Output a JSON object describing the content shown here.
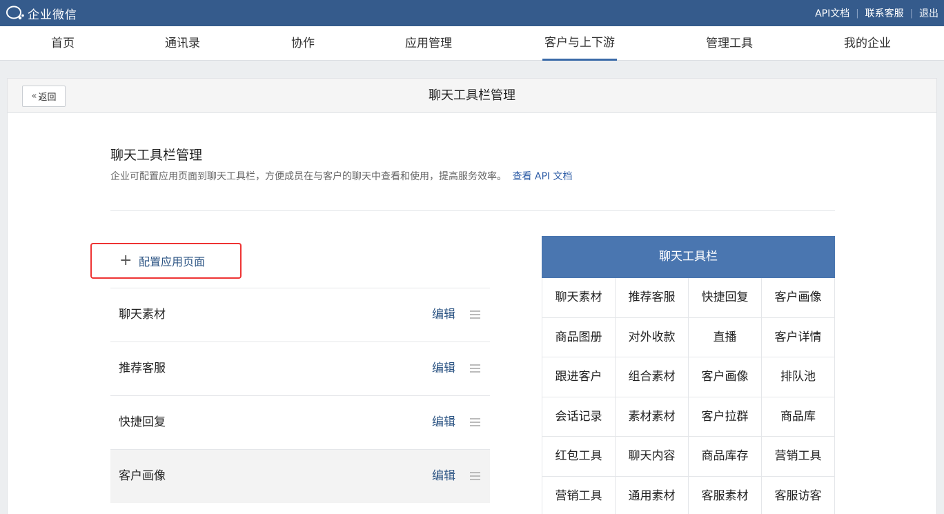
{
  "topbar": {
    "logo_text": "企业微信",
    "links": [
      "API文档",
      "联系客服",
      "退出"
    ]
  },
  "nav": {
    "items": [
      "首页",
      "通讯录",
      "协作",
      "应用管理",
      "客户与上下游",
      "管理工具",
      "我的企业"
    ],
    "active": "客户与上下游"
  },
  "panel": {
    "back_label": "返回",
    "title": "聊天工具栏管理"
  },
  "section": {
    "title": "聊天工具栏管理",
    "description": "企业可配置应用页面到聊天工具栏，方便成员在与客户的聊天中查看和使用，提高服务效率。",
    "api_link": "查看 API 文档"
  },
  "config_button": {
    "label": "配置应用页面"
  },
  "app_list": {
    "edit_label": "编辑",
    "items": [
      "聊天素材",
      "推荐客服",
      "快捷回复",
      "客户画像"
    ]
  },
  "toolbar": {
    "title": "聊天工具栏",
    "cells": [
      "聊天素材",
      "推荐客服",
      "快捷回复",
      "客户画像",
      "商品图册",
      "对外收款",
      "直播",
      "客户详情",
      "跟进客户",
      "组合素材",
      "客户画像",
      "排队池",
      "会话记录",
      "素材素材",
      "客户拉群",
      "商品库",
      "红包工具",
      "聊天内容",
      "商品库存",
      "营销工具",
      "营销工具",
      "通用素材",
      "客服素材",
      "客服访客"
    ]
  },
  "colors": {
    "topbar": "#355b8c",
    "accent": "#4a76b0",
    "link": "#2d5584",
    "highlight_border": "#e33333"
  }
}
